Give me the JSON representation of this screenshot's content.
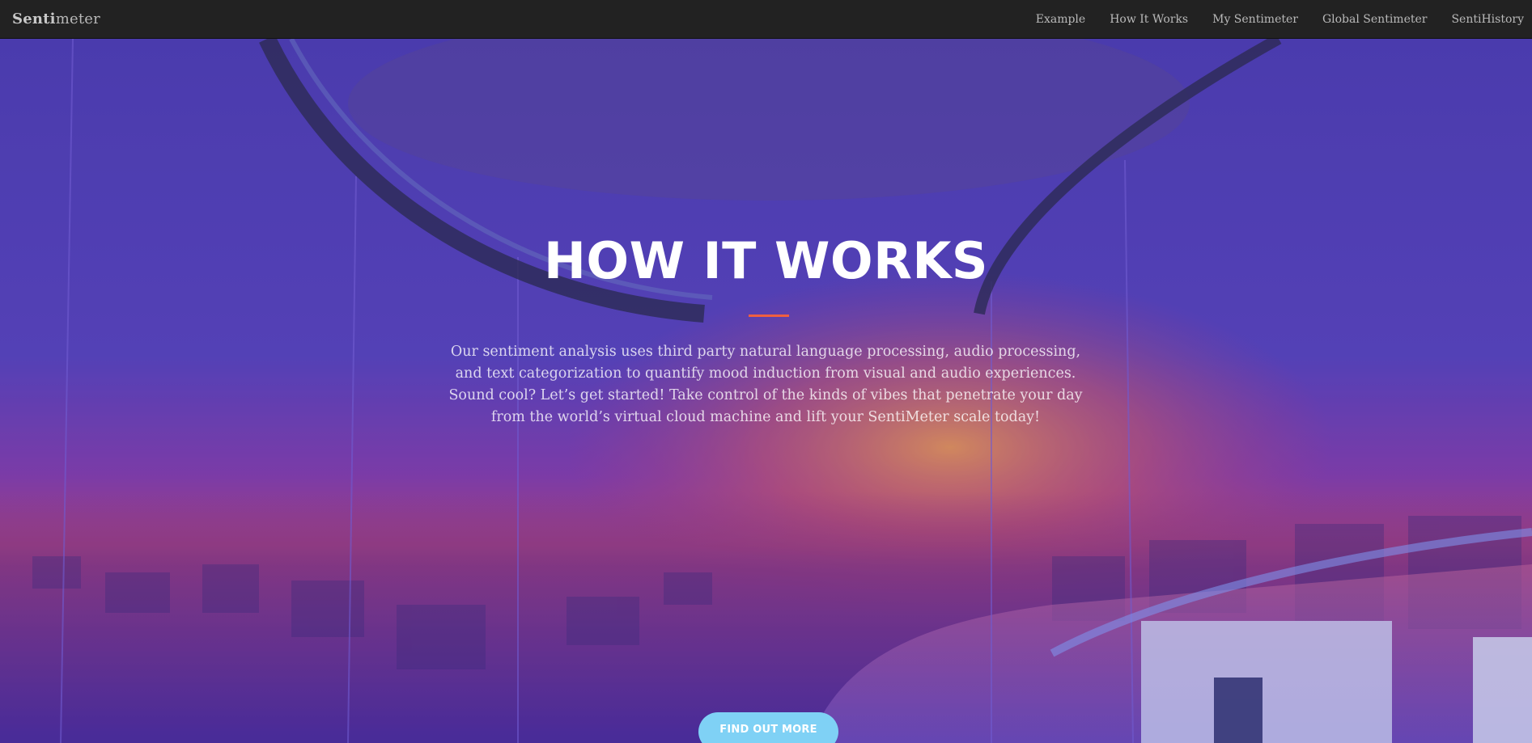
{
  "navbar": {
    "brand_bold": "Senti",
    "brand_rest": "meter",
    "links": [
      {
        "label": "Example"
      },
      {
        "label": "How It Works"
      },
      {
        "label": "My Sentimeter"
      },
      {
        "label": "Global Sentimeter"
      },
      {
        "label": "SentiHistory"
      }
    ]
  },
  "hero": {
    "title": "HOW IT WORKS",
    "text": "Our sentiment analysis uses third party natural language processing, audio processing, and text categorization to quantify mood induction from visual and audio experiences. Sound cool? Let’s get started! Take control of the kinds of vibes that penetrate your day from the world’s virtual cloud machine and lift your SentiMeter scale today!",
    "cta_label": "FIND OUT MORE",
    "background_image": "rainbow-panorama-photo"
  },
  "colors": {
    "navbar_bg": "#222222",
    "accent_divider": "#f05f40",
    "cta_bg": "#7fd1f5",
    "overlay": "#5a3cc8"
  }
}
